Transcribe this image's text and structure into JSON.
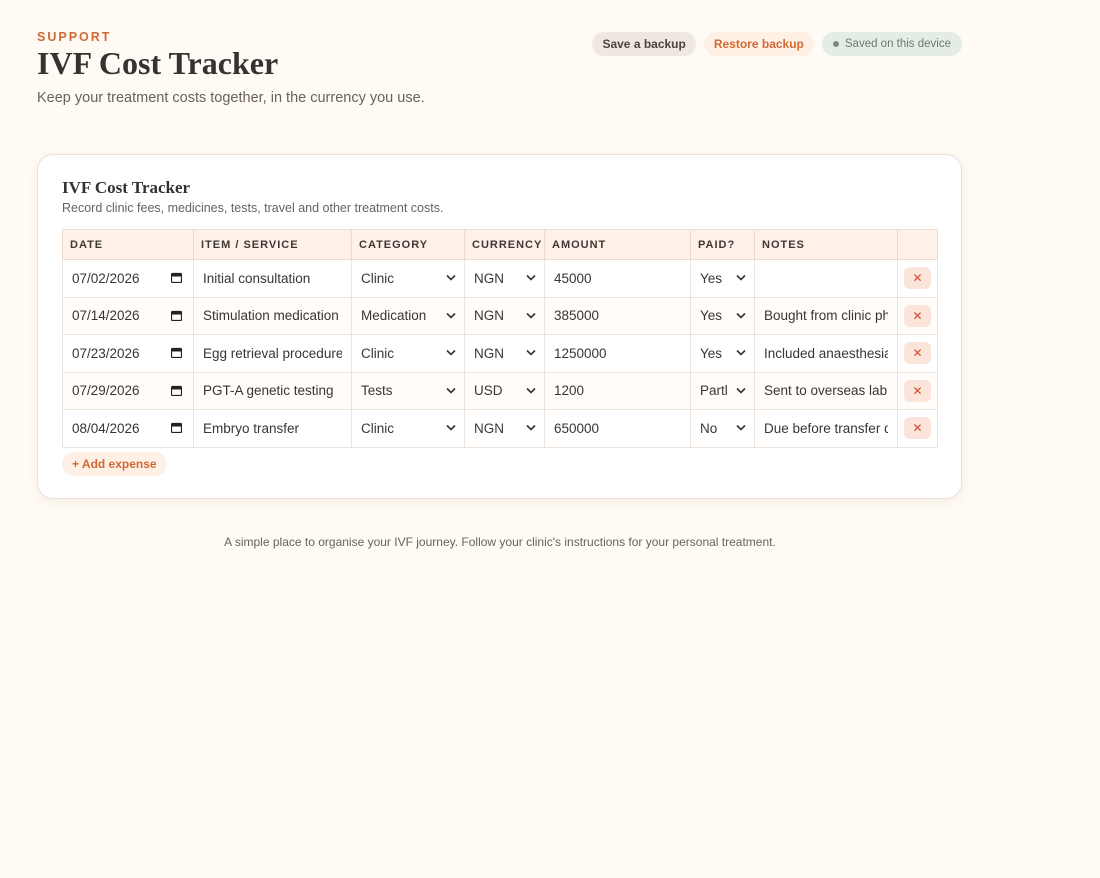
{
  "header": {
    "eyebrow": "SUPPORT",
    "title": "IVF Cost Tracker",
    "subtitle": "Keep your treatment costs together, in the currency you use.",
    "save_backup_label": "Save a backup",
    "restore_backup_label": "Restore backup",
    "status_text": "Saved on this device"
  },
  "card": {
    "title": "IVF Cost Tracker",
    "subtitle": "Record clinic fees, medicines, tests, travel and other treatment costs.",
    "add_label": "+ Add expense"
  },
  "table": {
    "columns": [
      "DATE",
      "ITEM / SERVICE",
      "CATEGORY",
      "CURRENCY",
      "AMOUNT",
      "PAID?",
      "NOTES",
      ""
    ],
    "rows": [
      {
        "date": "07/02/2026",
        "item": "Initial consultation",
        "category": "Clinic",
        "currency": "NGN",
        "amount": "45000",
        "paid": "Yes",
        "notes": ""
      },
      {
        "date": "07/14/2026",
        "item": "Stimulation medication",
        "category": "Medication",
        "currency": "NGN",
        "amount": "385000",
        "paid": "Yes",
        "notes": "Bought from clinic pha"
      },
      {
        "date": "07/23/2026",
        "item": "Egg retrieval procedure",
        "category": "Clinic",
        "currency": "NGN",
        "amount": "1250000",
        "paid": "Yes",
        "notes": "Included anaesthesia"
      },
      {
        "date": "07/29/2026",
        "item": "PGT-A genetic testing",
        "category": "Tests",
        "currency": "USD",
        "amount": "1200",
        "paid": "Partl",
        "notes": "Sent to overseas lab"
      },
      {
        "date": "08/04/2026",
        "item": "Embryo transfer",
        "category": "Clinic",
        "currency": "NGN",
        "amount": "650000",
        "paid": "No",
        "notes": "Due before transfer da"
      }
    ],
    "delete_glyph": "✕"
  },
  "footer": {
    "text": "A simple place to organise your IVF journey. Follow your clinic's instructions for your personal treatment."
  },
  "colors": {
    "accent": "#d06a35",
    "background": "#fffaf4",
    "header_row": "#fff1e8",
    "status_bg": "#e4ece6",
    "delete_bg": "#fbe4da"
  },
  "icons": [
    "calendar-icon",
    "chevron-down-icon",
    "close-icon",
    "status-dot-icon"
  ]
}
